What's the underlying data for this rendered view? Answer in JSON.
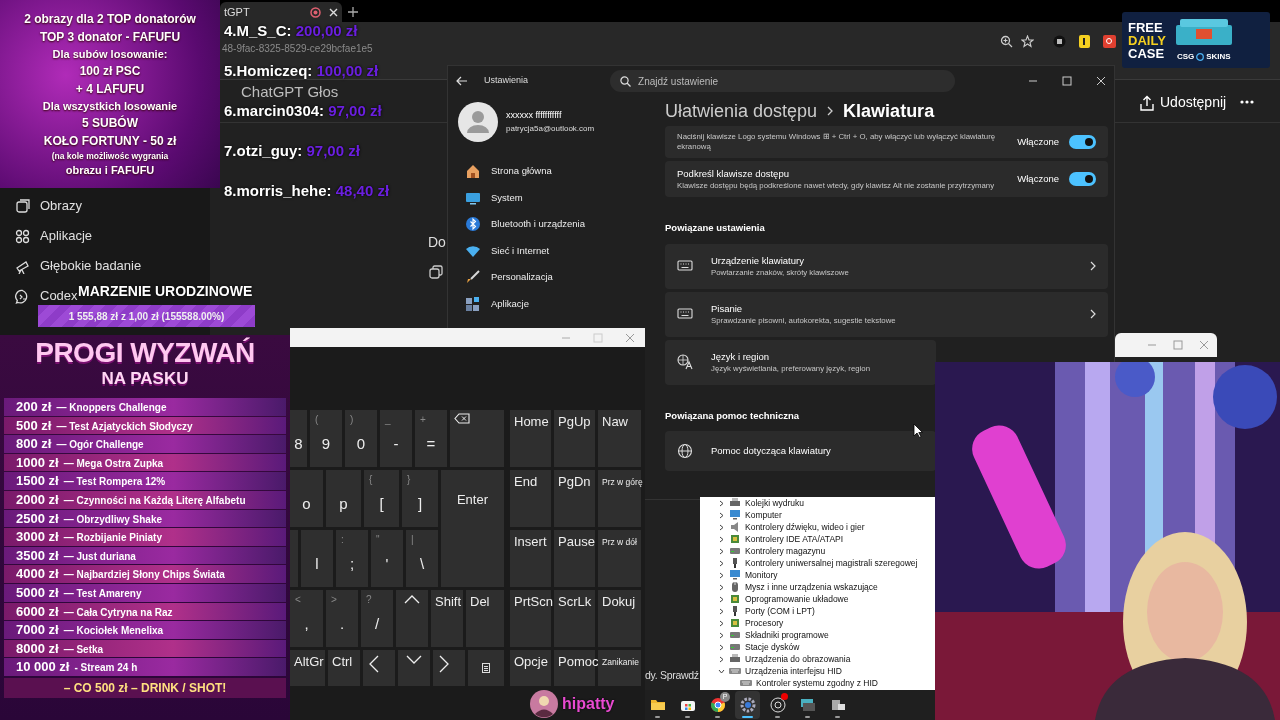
{
  "browser": {
    "tab_title": "tGPT",
    "url": "48-9fac-8325-8529-ce29bcfae1e5",
    "voice_title": "ChatGPT Głos",
    "share_label": "Udostępnij",
    "sidebar": [
      {
        "label": "Obrazy",
        "kind": "images"
      },
      {
        "label": "Aplikacje",
        "kind": "apps"
      },
      {
        "label": "Głębokie badanie",
        "kind": "research"
      },
      {
        "label": "Codex",
        "kind": "codex"
      }
    ],
    "side_text": "Do",
    "input_hint": "dy. Sprawdź"
  },
  "promo": {
    "lines": [
      {
        "text": "2 obrazy dla 2 TOP donatorów",
        "kind": "big"
      },
      {
        "text": "TOP 3 donator - FAFUFU",
        "kind": "big"
      },
      {
        "text": "Dla subów losowanie:",
        "kind": "normal"
      },
      {
        "text": "100 zł PSC",
        "kind": "big"
      },
      {
        "text": "+ 4 LAFUFU",
        "kind": "big"
      },
      {
        "text": "Dla wszystkich losowanie",
        "kind": "normal"
      },
      {
        "text": "5 SUBÓW",
        "kind": "big"
      },
      {
        "text": "KOŁO FORTUNY - 50 zł",
        "kind": "big"
      },
      {
        "text": "(na kole możliwośc wygrania",
        "kind": "small"
      },
      {
        "text": "obrazu i FAFUFU",
        "kind": "normal"
      }
    ]
  },
  "donations": [
    {
      "name": "4.M_S_C:",
      "amount": "200,00 zł"
    },
    {
      "name": "5.Homiczeq:",
      "amount": "100,00 zł"
    },
    {
      "name": "6.marcin0304:",
      "amount": "97,00 zł"
    },
    {
      "name": "7.otzi_guy:",
      "amount": "97,00 zł"
    },
    {
      "name": "8.morris_hehe:",
      "amount": "48,40 zł"
    }
  ],
  "goal": {
    "title": "MARZENIE URODZINOWE",
    "progress_text": "1 555,88 zł z 1,00 zł (155588.00%)",
    "level": 1
  },
  "settings": {
    "title": "Ustawienia",
    "search_placeholder": "Znajdź ustawienie",
    "user": {
      "name": "xxxxxx fffffffffff",
      "email": "patrycja5a@outlook.com"
    },
    "nav": [
      {
        "label": "Strona główna",
        "kind": "home"
      },
      {
        "label": "System",
        "kind": "system"
      },
      {
        "label": "Bluetooth i urządzenia",
        "kind": "bluetooth"
      },
      {
        "label": "Sieć i Internet",
        "kind": "network"
      },
      {
        "label": "Personalizacja",
        "kind": "brush"
      },
      {
        "label": "Aplikacje",
        "kind": "apps"
      }
    ],
    "breadcrumb": [
      "Ułatwienia dostępu",
      "Klawiatura"
    ],
    "toggles": [
      {
        "description": "Naciśnij klawisze Logo systemu Windows ⊞ + Ctrl + O, aby włączyć lub wyłączyć klawiaturę ekranową",
        "state_label": "Włączone",
        "on": true
      },
      {
        "title": "Podkreśl klawisze dostępu",
        "description": "Klawisze dostępu będą podkreślone nawet wtedy, gdy klawisz Alt nie zostanie przytrzymany",
        "state_label": "Włączone",
        "on": true
      }
    ],
    "related_heading": "Powiązane ustawienia",
    "related": [
      {
        "kind": "keyboard",
        "title": "Urządzenie klawiatury",
        "description": "Powtarzanie znaków, skróty klawiszowe",
        "arrow": true
      },
      {
        "kind": "keyboard",
        "title": "Pisanie",
        "description": "Sprawdzanie pisowni, autokorekta, sugestie tekstowe",
        "arrow": true
      },
      {
        "kind": "language",
        "title": "Język i region",
        "description": "Język wyświetlania, preferowany język, region",
        "arrow": false
      }
    ],
    "help_heading": "Powiązana pomoc techniczna",
    "help": [
      {
        "kind": "globe",
        "title": "Pomoc dotycząca klawiatury"
      }
    ]
  },
  "keyboard": {
    "main": [
      [
        {
          "kind": "char",
          "main": "8"
        },
        {
          "kind": "char",
          "main": "9",
          "shift": "("
        },
        {
          "kind": "char",
          "main": "0",
          "shift": ")"
        },
        {
          "kind": "char",
          "main": "-",
          "shift": "_"
        },
        {
          "kind": "char",
          "main": "=",
          "shift": "+"
        },
        {
          "kind": "backspace"
        }
      ],
      [
        {
          "kind": "char",
          "main": "o"
        },
        {
          "kind": "char",
          "main": "p"
        },
        {
          "kind": "char",
          "main": "[",
          "shift": "{"
        },
        {
          "kind": "char",
          "main": "]",
          "shift": "}"
        },
        {
          "kind": "enter",
          "label": "Enter"
        }
      ],
      [
        {
          "kind": "blank"
        },
        {
          "kind": "char",
          "main": "l"
        },
        {
          "kind": "char",
          "main": ";",
          "shift": ":"
        },
        {
          "kind": "char",
          "main": "'",
          "shift": "\""
        },
        {
          "kind": "char",
          "main": "\\",
          "shift": "|"
        }
      ],
      [
        {
          "kind": "char",
          "main": ",",
          "shift": "<"
        },
        {
          "kind": "char",
          "main": ".",
          "shift": ">"
        },
        {
          "kind": "char",
          "main": "/",
          "shift": "?"
        },
        {
          "kind": "up"
        },
        {
          "kind": "label",
          "label": "Shift"
        },
        {
          "kind": "label",
          "label": "Del"
        }
      ],
      [
        {
          "kind": "label",
          "label": "AltGr"
        },
        {
          "kind": "label",
          "label": "Ctrl"
        },
        {
          "kind": "left"
        },
        {
          "kind": "down"
        },
        {
          "kind": "right"
        },
        {
          "kind": "menu"
        }
      ]
    ],
    "nav": [
      "Home",
      "PgUp",
      "Naw",
      "End",
      "PgDn",
      "Prz w górę",
      "Insert",
      "Pause",
      "Prz w dół",
      "PrtScn",
      "ScrLk",
      "Dokuj",
      "Opcje",
      "Pomoc",
      "Zanikanie"
    ]
  },
  "device_manager": {
    "items": [
      {
        "label": "Kolejki wydruku",
        "kind": "printer",
        "expanded": false
      },
      {
        "label": "Komputer",
        "kind": "monitor",
        "expanded": false
      },
      {
        "label": "Kontrolery dźwięku, wideo i gier",
        "kind": "speaker",
        "expanded": false
      },
      {
        "label": "Kontrolery IDE ATA/ATAPI",
        "kind": "chip",
        "expanded": false
      },
      {
        "label": "Kontrolery magazynu",
        "kind": "drive",
        "expanded": false
      },
      {
        "label": "Kontrolery uniwersalnej magistrali szeregowej",
        "kind": "plug",
        "expanded": false
      },
      {
        "label": "Monitory",
        "kind": "monitor",
        "expanded": false
      },
      {
        "label": "Mysz i inne urządzenia wskazujące",
        "kind": "mouse",
        "expanded": false
      },
      {
        "label": "Oprogramowanie układowe",
        "kind": "chip",
        "expanded": false
      },
      {
        "label": "Porty (COM i LPT)",
        "kind": "plug",
        "expanded": false
      },
      {
        "label": "Procesory",
        "kind": "chip",
        "expanded": false
      },
      {
        "label": "Składniki programowe",
        "kind": "drive",
        "expanded": false
      },
      {
        "label": "Stacje dysków",
        "kind": "drive",
        "expanded": false
      },
      {
        "label": "Urządzenia do obrazowania",
        "kind": "printer",
        "expanded": false
      },
      {
        "label": "Urządzenia interfejsu HID",
        "kind": "keyboard",
        "expanded": true,
        "children": [
          {
            "label": "Kontroler systemu zgodny z HID",
            "kind": "keyboard"
          }
        ]
      }
    ]
  },
  "taskbar": {
    "apps": [
      {
        "kind": "folder",
        "selected": false,
        "notification": false
      },
      {
        "kind": "store",
        "selected": false,
        "notification": false
      },
      {
        "kind": "browser",
        "selected": false,
        "notification": false,
        "badge": "P"
      },
      {
        "kind": "settings",
        "selected": true,
        "notification": false
      },
      {
        "kind": "recorder",
        "selected": false,
        "notification": true
      },
      {
        "kind": "keyboard",
        "selected": false,
        "notification": false
      },
      {
        "kind": "devices",
        "selected": false,
        "notification": false
      }
    ]
  },
  "ad": {
    "lines": [
      {
        "text": "FREE",
        "color": "#ffffff"
      },
      {
        "text": "DAILY",
        "color": "#f5d020"
      },
      {
        "text": "CASE",
        "color": "#ffffff"
      }
    ],
    "brand_left": "CSG",
    "brand_right": "SKINS"
  },
  "challenges": {
    "title": "PROGI WYZWAŃ",
    "subtitle": "NA PASKU",
    "rows": [
      {
        "amount": "200 zł",
        "label": "— Knoppers Challenge"
      },
      {
        "amount": "500 zł",
        "label": "— Test Azjatyckich Słodyczy"
      },
      {
        "amount": "800 zł",
        "label": "— Ogór Challenge"
      },
      {
        "amount": "1000 zł",
        "label": "— Mega Ostra Zupka"
      },
      {
        "amount": "1500 zł",
        "label": "— Test Rompera 12%"
      },
      {
        "amount": "2000 zł",
        "label": "— Czynności na Każdą Literę Alfabetu"
      },
      {
        "amount": "2500 zł",
        "label": "— Obrzydliwy Shake"
      },
      {
        "amount": "3000 zł",
        "label": "— Rozbijanie Piniaty"
      },
      {
        "amount": "3500 zł",
        "label": "— Just duriana"
      },
      {
        "amount": "4000 zł",
        "label": "— Najbardziej Słony Chips Świata"
      },
      {
        "amount": "5000 zł",
        "label": "— Test Amareny"
      },
      {
        "amount": "6000 zł",
        "label": "— Cała Cytryna na Raz"
      },
      {
        "amount": "7000 zł",
        "label": "— Kociołek Menelixa"
      },
      {
        "amount": "8000 zł",
        "label": "— Setka"
      },
      {
        "amount": "10 000 zł",
        "label": "- Stream 24 h"
      }
    ],
    "footer": "– CO 500 zł – DRINK / SHOT!"
  },
  "streamer": {
    "name": "hipatty"
  }
}
